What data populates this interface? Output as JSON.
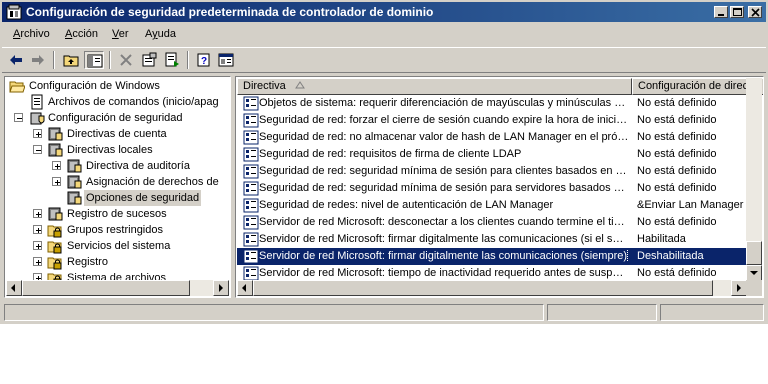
{
  "window": {
    "title": "Configuración de seguridad predeterminada de controlador de dominio"
  },
  "menu": [
    {
      "label": "Archivo",
      "mnemonic": "A",
      "rest": "rchivo"
    },
    {
      "label": "Acción",
      "mnemonic": "A",
      "rest": "cción"
    },
    {
      "label": "Ver",
      "mnemonic": "V",
      "rest": "er"
    },
    {
      "label": "Ayuda",
      "mnemonic": "y",
      "pre": "A",
      "rest": "uda"
    }
  ],
  "toolbar": [
    "back-icon",
    "forward-icon",
    "up-folder-icon",
    "show-hide-tree-icon",
    "delete-icon",
    "properties-icon",
    "export-list-icon",
    "help-icon",
    "show-description-icon"
  ],
  "tree": {
    "items": [
      {
        "label": "Configuración de Windows",
        "level": 0
      },
      {
        "label": "Archivos de comandos (inicio/apag",
        "level": 1
      },
      {
        "label": "Configuración de seguridad",
        "level": 1
      },
      {
        "label": "Directivas de cuenta",
        "level": 2
      },
      {
        "label": "Directivas locales",
        "level": 2
      },
      {
        "label": "Directiva de auditoría",
        "level": 3
      },
      {
        "label": "Asignación de derechos de",
        "level": 3
      },
      {
        "label": "Opciones de seguridad",
        "level": 3
      },
      {
        "label": "Registro de sucesos",
        "level": 2
      },
      {
        "label": "Grupos restringidos",
        "level": 2
      },
      {
        "label": "Servicios del sistema",
        "level": 2
      },
      {
        "label": "Registro",
        "level": 2
      },
      {
        "label": "Sistema de archivos",
        "level": 2
      }
    ]
  },
  "list": {
    "columns": [
      "Directiva",
      "Configuración de directi"
    ],
    "rows": [
      {
        "policy": "Objetos de sistema: requerir diferenciación de mayúsculas y minúsculas para subsistemas que no sean de Windows",
        "setting": "No está definido"
      },
      {
        "policy": "Seguridad de red: forzar el cierre de sesión cuando expire la hora de inicio de sesión",
        "setting": "No está definido"
      },
      {
        "policy": "Seguridad de red: no almacenar valor de hash de LAN Manager en el próximo cambio de contraseña",
        "setting": "No está definido"
      },
      {
        "policy": "Seguridad de red: requisitos de firma de cliente LDAP",
        "setting": "No está definido"
      },
      {
        "policy": "Seguridad de red: seguridad mínima de sesión para clientes basados en NTLM SSP",
        "setting": "No está definido"
      },
      {
        "policy": "Seguridad de red: seguridad mínima de sesión para servidores basados en NTLM SSP",
        "setting": "No está definido"
      },
      {
        "policy": "Seguridad de redes: nivel de autenticación de LAN Manager",
        "setting": "&Enviar Lan Manager y NTLM"
      },
      {
        "policy": "Servidor de red Microsoft: desconectar a los clientes cuando termine el tiempo de inicio de sesión",
        "setting": "No está definido"
      },
      {
        "policy": "Servidor de red Microsoft: firmar digitalmente las comunicaciones (si el servidor lo permite)",
        "setting": "Habilitada"
      },
      {
        "policy": "Servidor de red Microsoft: firmar digitalmente las comunicaciones (siempre)",
        "setting": "Deshabilitada"
      },
      {
        "policy": "Servidor de red Microsoft: tiempo de inactividad requerido antes de suspender la sesión",
        "setting": "No está definido"
      }
    ],
    "selected_index": 9
  }
}
